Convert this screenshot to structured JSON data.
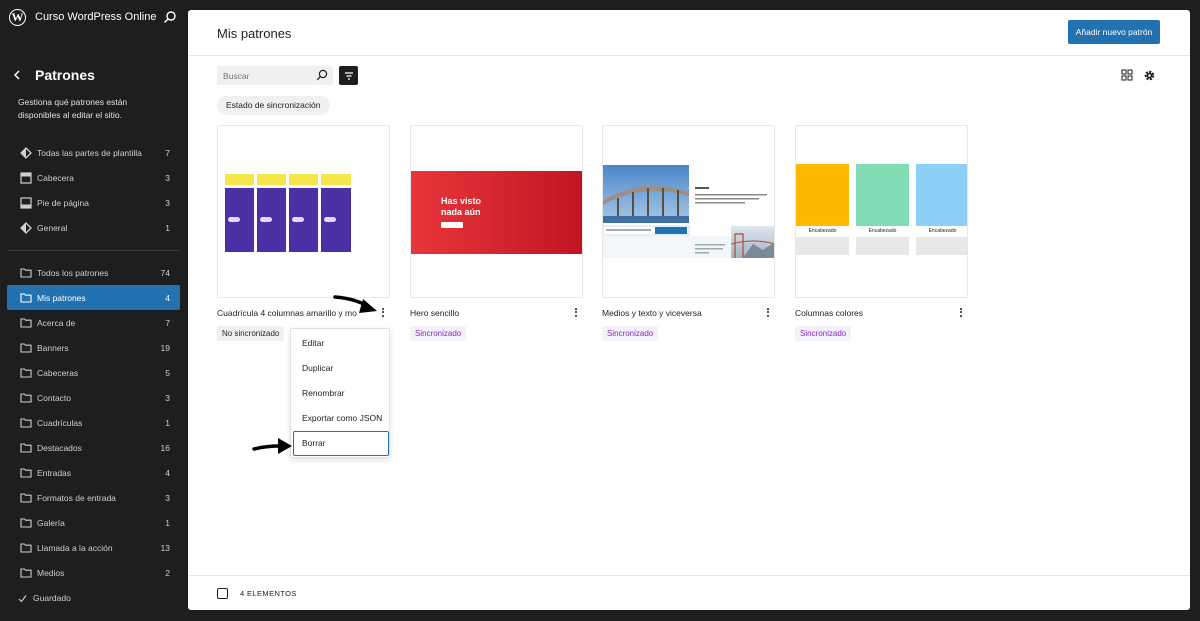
{
  "site": {
    "name": "Curso WordPress Online"
  },
  "sidebar": {
    "title": "Patrones",
    "description": "Gestiona qué patrones están disponibles al editar el sitio.",
    "template_parts": [
      {
        "label": "Todas las partes de plantilla",
        "count": "7",
        "icon": "diamond-icon"
      },
      {
        "label": "Cabecera",
        "count": "3",
        "icon": "header-icon"
      },
      {
        "label": "Pie de página",
        "count": "3",
        "icon": "footer-icon"
      },
      {
        "label": "General",
        "count": "1",
        "icon": "diamond-icon"
      }
    ],
    "categories": [
      {
        "label": "Todos los patrones",
        "count": "74"
      },
      {
        "label": "Mis patrones",
        "count": "4",
        "active": true
      },
      {
        "label": "Acerca de",
        "count": "7"
      },
      {
        "label": "Banners",
        "count": "19"
      },
      {
        "label": "Cabeceras",
        "count": "5"
      },
      {
        "label": "Contacto",
        "count": "3"
      },
      {
        "label": "Cuadrículas",
        "count": "1"
      },
      {
        "label": "Destacados",
        "count": "16"
      },
      {
        "label": "Entradas",
        "count": "4"
      },
      {
        "label": "Formatos de entrada",
        "count": "3"
      },
      {
        "label": "Galería",
        "count": "1"
      },
      {
        "label": "Llamada a la acción",
        "count": "13"
      },
      {
        "label": "Medios",
        "count": "2"
      }
    ],
    "saved_label": "Guardado"
  },
  "main": {
    "title": "Mis patrones",
    "add_button": "Añadir nuevo patrón",
    "search_placeholder": "Buscar",
    "filter_chip": "Estado de sincronización",
    "patterns": [
      {
        "title": "Cuadrícula 4 columnas amarillo y mo",
        "status": "No sincronizado",
        "synced": false
      },
      {
        "title": "Hero sencillo",
        "status": "Sincronizado",
        "synced": true,
        "hero_text": "Has visto nada aún"
      },
      {
        "title": "Medios y texto y viceversa",
        "status": "Sincronizado",
        "synced": true
      },
      {
        "title": "Columnas colores",
        "status": "Sincronizado",
        "synced": true,
        "col_label": "Encabezado"
      }
    ],
    "menu": [
      "Editar",
      "Duplicar",
      "Renombrar",
      "Exportar como JSON",
      "Borrar"
    ],
    "count_label": "4 ELEMENTOS"
  },
  "colors": {
    "accent": "#2271b1",
    "sidebar_bg": "#1e1e1e",
    "synced": "#8b26c6",
    "yellow": "#f5e64e",
    "purple": "#4b2fa4",
    "hero_red": "#e8363a",
    "col_orange": "#fbb900",
    "col_green": "#7fdcb3",
    "col_blue": "#8ecff8"
  }
}
